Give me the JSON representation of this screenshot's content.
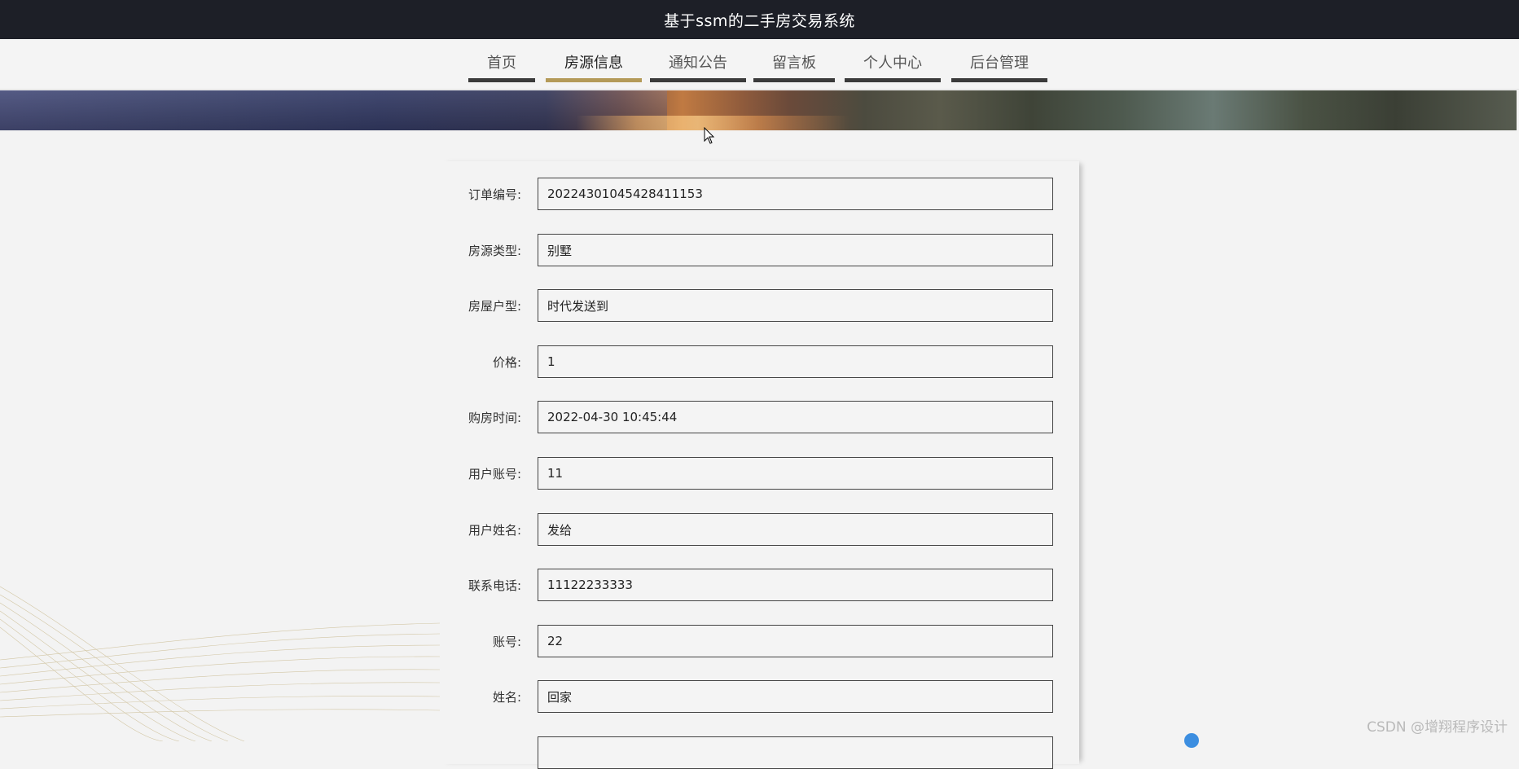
{
  "app": {
    "title": "基于ssm的二手房交易系统"
  },
  "nav": {
    "items": [
      {
        "label": "首页",
        "active": false
      },
      {
        "label": "房源信息",
        "active": true
      },
      {
        "label": "通知公告",
        "active": false
      },
      {
        "label": "留言板",
        "active": false
      },
      {
        "label": "个人中心",
        "active": false
      },
      {
        "label": "后台管理",
        "active": false
      }
    ]
  },
  "form": {
    "fields": [
      {
        "label": "订单编号:",
        "value": "20224301045428411153"
      },
      {
        "label": "房源类型:",
        "value": "别墅"
      },
      {
        "label": "房屋户型:",
        "value": "时代发送到"
      },
      {
        "label": "价格:",
        "value": "1"
      },
      {
        "label": "购房时间:",
        "value": "2022-04-30 10:45:44"
      },
      {
        "label": "用户账号:",
        "value": "11"
      },
      {
        "label": "用户姓名:",
        "value": "发给"
      },
      {
        "label": "联系电话:",
        "value": "11122233333"
      },
      {
        "label": "账号:",
        "value": "22"
      },
      {
        "label": "姓名:",
        "value": "回家"
      },
      {
        "label": "",
        "value": ""
      }
    ]
  },
  "watermark": "CSDN @增翔程序设计",
  "colors": {
    "topbar": "#1d1f27",
    "nav_active_underline": "#b49a58",
    "nav_underline": "#3b3b3b",
    "background": "#f3f3f3"
  }
}
